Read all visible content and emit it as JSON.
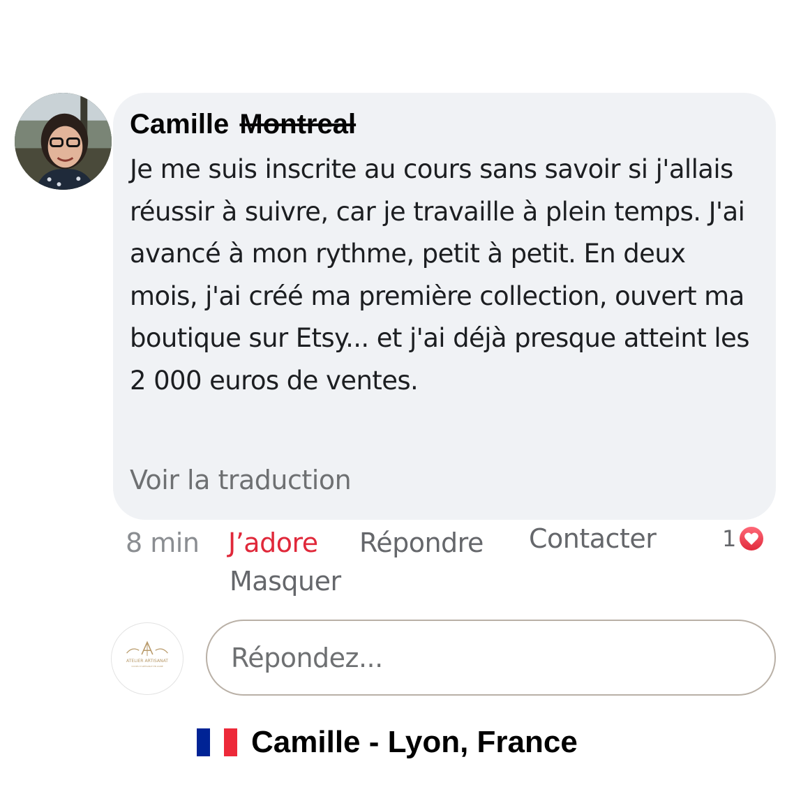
{
  "comment": {
    "author_first": "Camille",
    "author_struck": "Montreal",
    "text": "Je me suis inscrite au cours sans savoir si j'allais réussir à suivre, car je travaille à plein temps. J'ai avancé à mon rythme, petit à petit. En deux mois, j'ai créé ma première collection, ouvert ma boutique sur Etsy... et j'ai déjà presque atteint les 2 000 euros de ventes.",
    "translate_link": "Voir la traduction"
  },
  "actions": {
    "time": "8 min",
    "love": "J’adore",
    "reply": "Répondre",
    "contact": "Contacter",
    "hide": "Masquer",
    "reaction_count": "1",
    "reaction_icon": "heart-icon",
    "love_color": "#e0283a"
  },
  "reply_box": {
    "placeholder": "Répondez...",
    "brand_title": "ATELIER ARTISANAT",
    "brand_subtitle": "COURS D'ARTISANAT EN LIGNE",
    "brand_monogram": "A"
  },
  "caption": {
    "flag_icon": "france-flag-icon",
    "text": "Camille - Lyon, France",
    "flag_colors": [
      "#002395",
      "#ffffff",
      "#ed2939"
    ]
  }
}
